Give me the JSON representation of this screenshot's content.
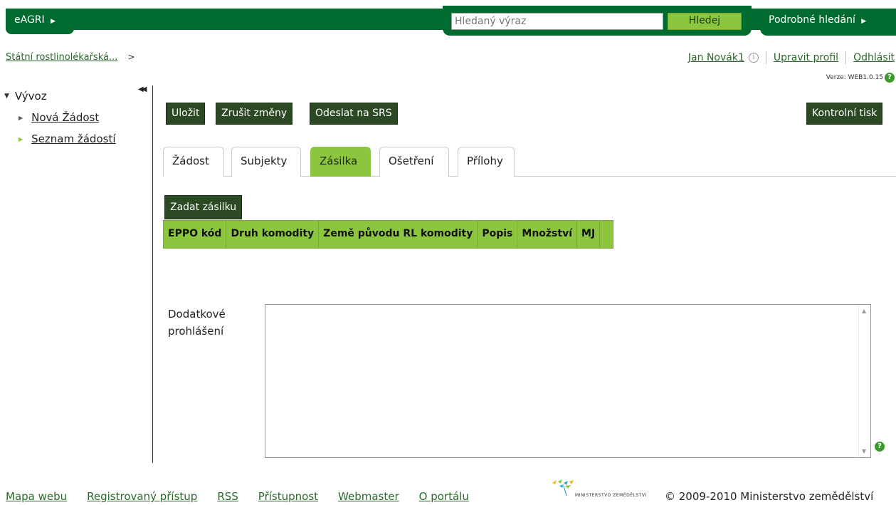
{
  "header": {
    "app_name": "eAGRI",
    "search_placeholder": "Hledaný výraz",
    "search_button": "Hledej",
    "advanced_search": "Podrobné hledání"
  },
  "breadcrumb": {
    "item": "Státní rostlinolékařská...",
    "separator": ">"
  },
  "user": {
    "name": "Jan Novák1",
    "edit_profile": "Upravit profil",
    "logout": "Odhlásit",
    "version": "Verze: WEB1.0.15"
  },
  "sidebar": {
    "section": "Vývoz",
    "items": [
      {
        "label": "Nová Žádost"
      },
      {
        "label": "Seznam žádostí"
      }
    ]
  },
  "toolbar": {
    "save": "Uložit",
    "cancel": "Zrušit změny",
    "send": "Odeslat na SRS",
    "print": "Kontrolní tisk"
  },
  "tabs": [
    {
      "label": "Žádost"
    },
    {
      "label": "Subjekty"
    },
    {
      "label": "Zásilka"
    },
    {
      "label": "Ošetření"
    },
    {
      "label": "Přílohy"
    }
  ],
  "active_tab": "Zásilka",
  "shipment": {
    "add_button": "Zadat zásilku",
    "columns": [
      "EPPO kód",
      "Druh komodity",
      "Země původu RL komodity",
      "Popis",
      "Množství",
      "MJ",
      ""
    ]
  },
  "additional_declaration": {
    "label_line1": "Dodatkové",
    "label_line2": "prohlášení",
    "value": ""
  },
  "footer": {
    "links": [
      "Mapa webu",
      "Registrovaný přístup",
      "RSS",
      "Přístupnost",
      "Webmaster",
      "O portálu"
    ],
    "ministry_logo_text": "MINISTERSTVO ZEMĚDĚLSTVÍ",
    "copyright": "© 2009-2010 Ministerstvo zemědělství"
  },
  "colors": {
    "brand_green": "#006b2f",
    "accent_green": "#8cc63f",
    "button_dark": "#2b4a23"
  }
}
